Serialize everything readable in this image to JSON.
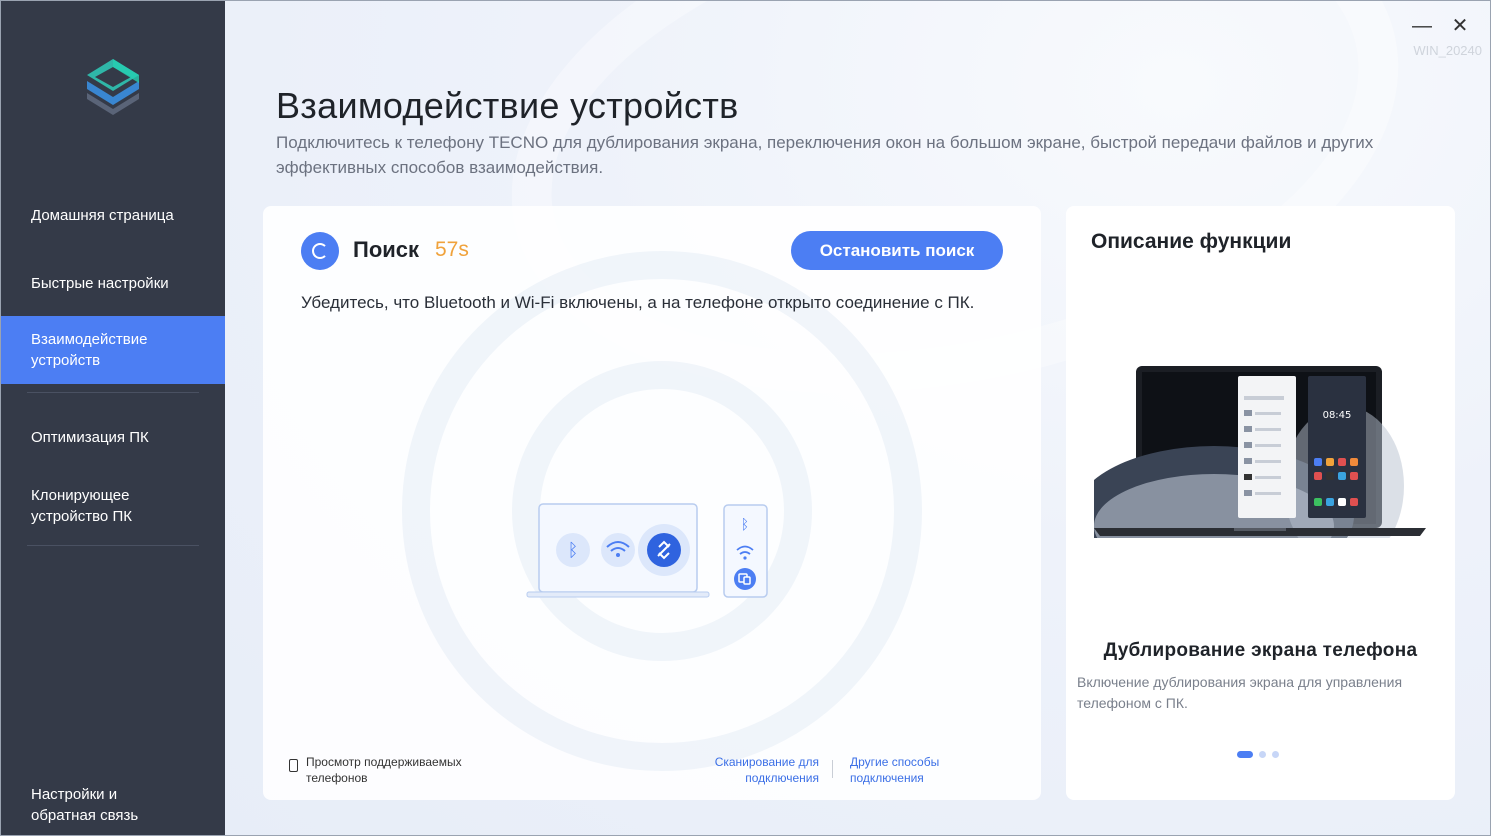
{
  "window": {
    "minimize_icon": "minimize-icon",
    "close_icon": "close-icon",
    "watermark": "WIN_20240"
  },
  "sidebar": {
    "items": [
      {
        "label": "Домашняя страница",
        "active": false
      },
      {
        "label": "Быстрые настройки",
        "active": false
      },
      {
        "label": "Взаимодействие устройств",
        "active": true
      },
      {
        "label": "Оптимизация ПК",
        "active": false
      },
      {
        "label": "Клонирующее устройство ПК",
        "active": false
      },
      {
        "label": "Настройки и обратная связь",
        "active": false
      }
    ]
  },
  "header": {
    "title": "Взаимодействие устройств",
    "subtitle": "Подключитесь к телефону TECNO для дублирования экрана, переключения окон на большом экране, быстрой передачи файлов и других эффективных способов взаимодействия."
  },
  "search": {
    "label": "Поиск",
    "timer": "57s",
    "stop_button": "Остановить поиск",
    "hint": "Убедитесь, что Bluetooth и Wi-Fi включены, а на телефоне открыто соединение с ПК.",
    "supported_phones_link": "Просмотр поддерживаемых телефонов",
    "scan_link": "Сканирование для подключения",
    "other_link": "Другие способы подключения"
  },
  "description": {
    "title": "Описание функции",
    "feature_title": "Дублирование экрана телефона",
    "feature_desc": "Включение дублирования экрана для управления телефоном с ПК.",
    "carousel_total": 3,
    "carousel_active": 1
  },
  "colors": {
    "accent": "#4c7ef3",
    "sidebar_bg": "#343a48",
    "timer": "#f0a23b",
    "link": "#3b6fe6"
  }
}
